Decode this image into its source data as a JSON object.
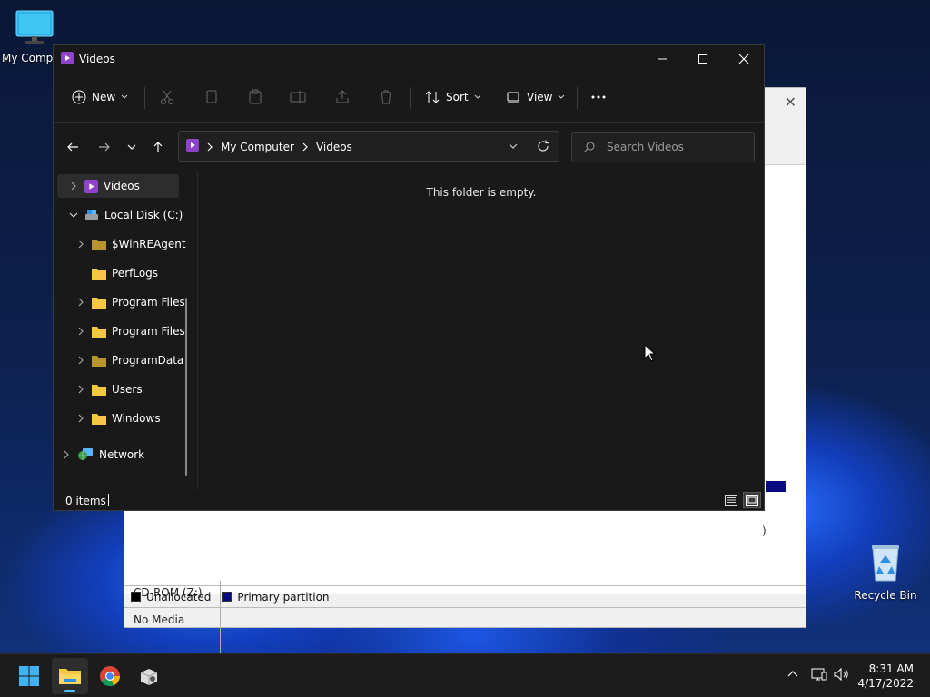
{
  "desktop": {
    "icons": [
      {
        "label": "My Compu",
        "icon": "monitor-icon"
      },
      {
        "label": "Recycle Bin",
        "icon": "recycle-bin-icon"
      }
    ]
  },
  "background_window": {
    "legend": [
      "Unallocated",
      "Primary partition"
    ],
    "cdrom_label": "CD-ROM (Z:)",
    "cdrom_status": "No Media",
    "partial_text": ")"
  },
  "explorer": {
    "title": "Videos",
    "toolbar": {
      "new_label": "New",
      "sort_label": "Sort",
      "view_label": "View",
      "actions": [
        "cut-icon",
        "copy-icon",
        "paste-icon",
        "rename-icon",
        "share-icon",
        "delete-icon",
        "more-icon"
      ]
    },
    "address": {
      "breadcrumbs": [
        "My Computer",
        "Videos"
      ]
    },
    "search": {
      "placeholder": "Search Videos"
    },
    "tree": [
      {
        "label": "Videos",
        "selected": true,
        "expandable": true
      },
      {
        "label": "Local Disk (C:)",
        "expanded": true
      },
      {
        "label": "$WinREAgent",
        "expandable": true
      },
      {
        "label": "PerfLogs",
        "expandable": false
      },
      {
        "label": "Program Files",
        "expandable": true
      },
      {
        "label": "Program Files",
        "expandable": true
      },
      {
        "label": "ProgramData",
        "expandable": true
      },
      {
        "label": "Users",
        "expandable": true
      },
      {
        "label": "Windows",
        "expandable": true
      },
      {
        "label": "Network",
        "expandable": true
      }
    ],
    "content": {
      "empty_message": "This folder is empty."
    },
    "status": {
      "item_count": "0 items"
    }
  },
  "taskbar": {
    "apps": [
      "start-icon",
      "file-explorer-icon",
      "chrome-icon",
      "installer-icon"
    ],
    "time": "8:31 AM",
    "date": "4/17/2022"
  },
  "colors": {
    "accent": "#4cc2ff",
    "folder": "#f4c842",
    "videos_purple": "#8e44c9",
    "window_bg": "#191919"
  }
}
